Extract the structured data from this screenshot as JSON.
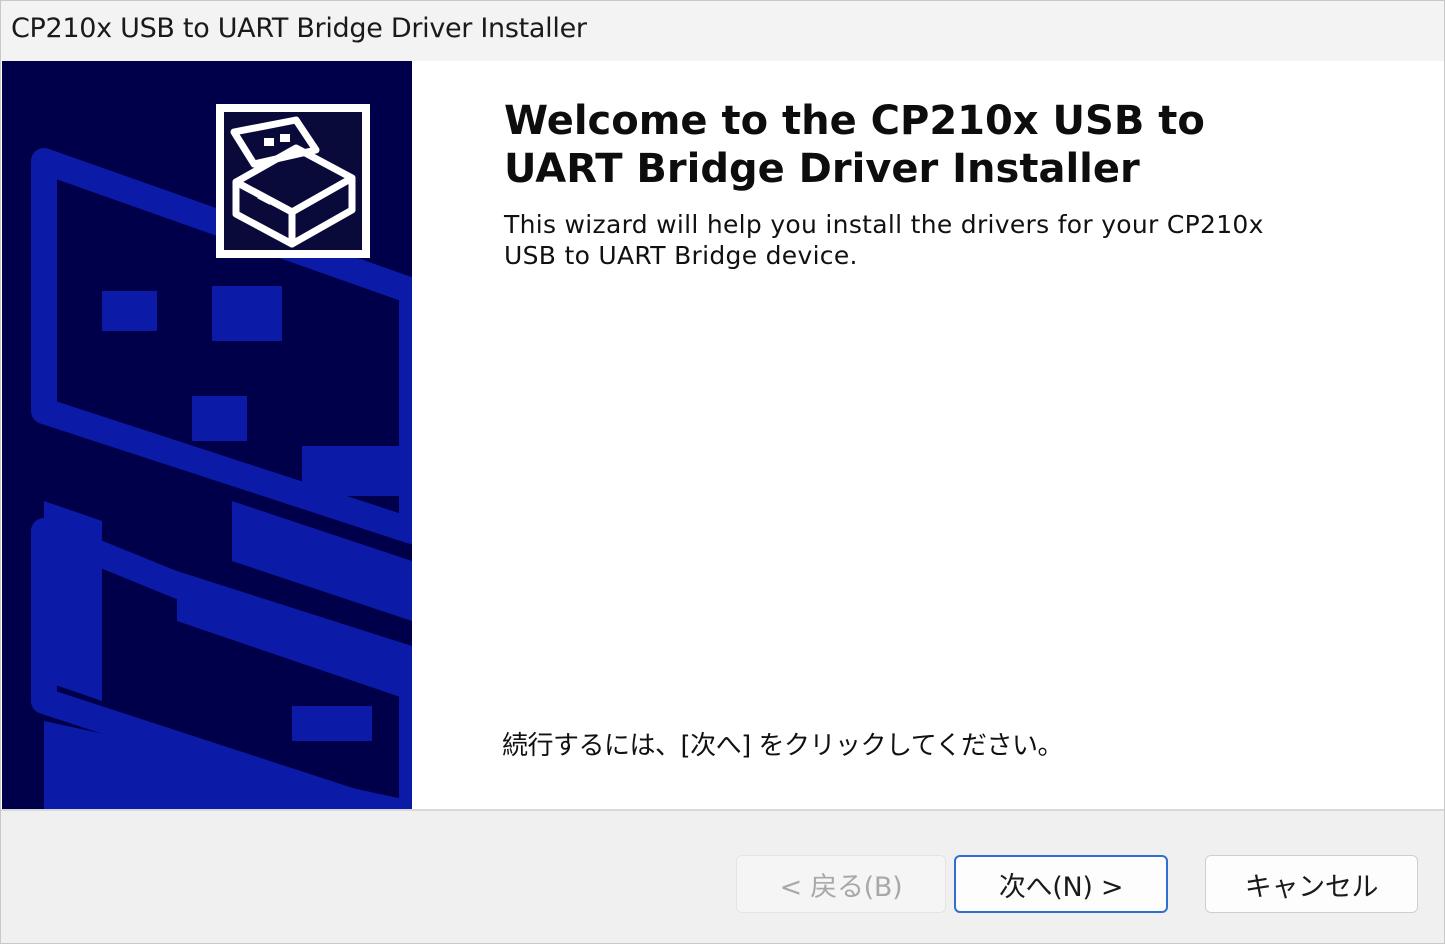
{
  "window": {
    "title": "CP210x USB to UART Bridge Driver Installer"
  },
  "welcome": {
    "heading": "Welcome to the CP210x USB to UART Bridge Driver Installer",
    "description": "This wizard will help you install the drivers for your CP210x USB to UART Bridge device.",
    "instruction": "続行するには、[次へ] をクリックしてください。"
  },
  "buttons": {
    "back_label": "< 戻る(B)",
    "next_label": "次へ(N) >",
    "cancel_label": "キャンセル"
  },
  "icons": {
    "sidebar_art": "wizard-sidebar-graphic",
    "logo": "installer-box-icon"
  },
  "colors": {
    "sidebar_background": "#00004a",
    "sidebar_art": "#0c1aa8",
    "focus_border": "#2f6fd1"
  }
}
